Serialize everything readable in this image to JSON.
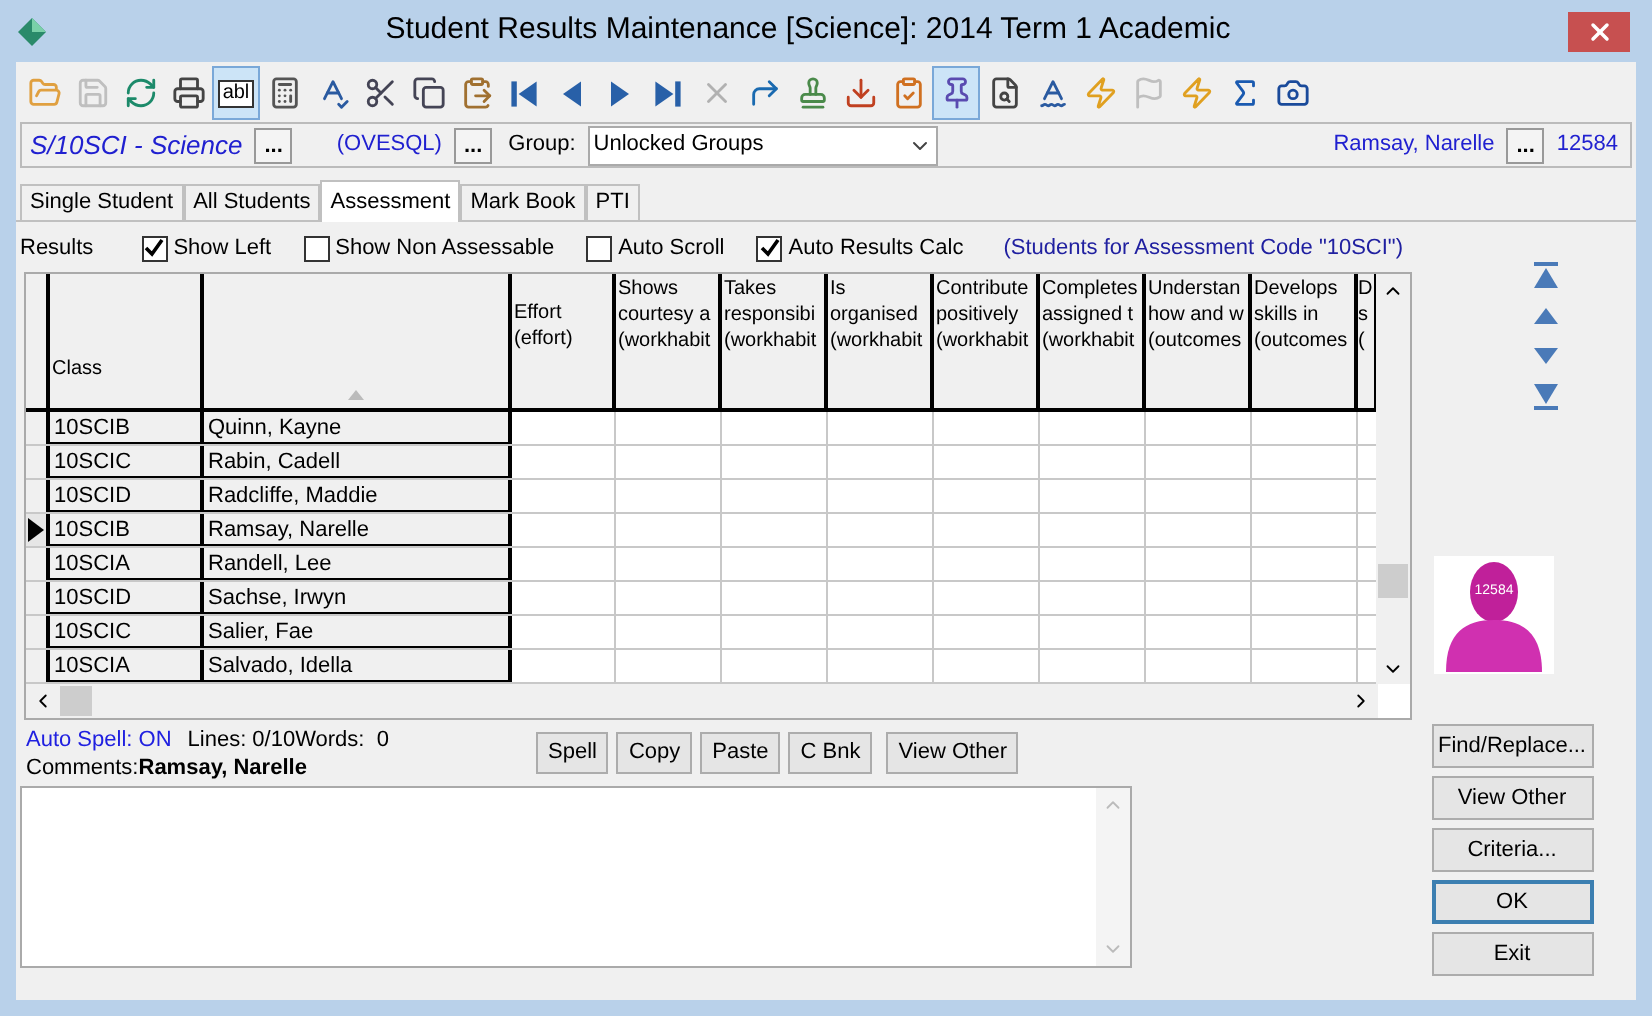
{
  "window": {
    "title": "Student Results Maintenance  [Science]:  2014 Term 1 Academic"
  },
  "toolbar": [
    {
      "kind": "open",
      "selected": false,
      "disabled": false
    },
    {
      "kind": "save",
      "selected": false,
      "disabled": true
    },
    {
      "kind": "refresh",
      "selected": false,
      "disabled": false
    },
    {
      "kind": "print",
      "selected": false,
      "disabled": false
    },
    {
      "kind": "field",
      "label": "abl",
      "selected": true,
      "disabled": false
    },
    {
      "kind": "calculator",
      "selected": false,
      "disabled": false
    },
    {
      "kind": "spell",
      "selected": false,
      "disabled": false
    },
    {
      "kind": "cut",
      "selected": false,
      "disabled": false
    },
    {
      "kind": "copy",
      "selected": false,
      "disabled": false
    },
    {
      "kind": "paste",
      "selected": false,
      "disabled": false
    },
    {
      "kind": "first",
      "selected": false,
      "disabled": false
    },
    {
      "kind": "prev",
      "selected": false,
      "disabled": false
    },
    {
      "kind": "next",
      "selected": false,
      "disabled": false
    },
    {
      "kind": "last",
      "selected": false,
      "disabled": false
    },
    {
      "kind": "delete",
      "selected": false,
      "disabled": true
    },
    {
      "kind": "jump",
      "selected": false,
      "disabled": false
    },
    {
      "kind": "approve",
      "selected": false,
      "disabled": false
    },
    {
      "kind": "import",
      "selected": false,
      "disabled": false
    },
    {
      "kind": "checklist",
      "selected": false,
      "disabled": false
    },
    {
      "kind": "pin",
      "selected": true,
      "disabled": false
    },
    {
      "kind": "preview",
      "selected": false,
      "disabled": false
    },
    {
      "kind": "spelladd",
      "selected": false,
      "disabled": false
    },
    {
      "kind": "font",
      "selected": false,
      "disabled": false
    },
    {
      "kind": "flag",
      "selected": false,
      "disabled": true
    },
    {
      "kind": "function",
      "selected": false,
      "disabled": false
    },
    {
      "kind": "sum",
      "selected": false,
      "disabled": false
    },
    {
      "kind": "camera",
      "selected": false,
      "disabled": false
    }
  ],
  "selector_bar": {
    "course": "S/10SCI - Science",
    "course_button": "...",
    "source": "(OVESQL)",
    "source_button": "...",
    "group_label": "Group:",
    "group_value": "Unlocked Groups",
    "student": "Ramsay, Narelle",
    "student_button": "...",
    "student_id": "12584"
  },
  "tabs": [
    {
      "label": "Single Student",
      "selected": false
    },
    {
      "label": "All Students",
      "selected": false
    },
    {
      "label": "Assessment",
      "selected": true
    },
    {
      "label": "Mark Book",
      "selected": false
    },
    {
      "label": "PTI",
      "selected": false
    }
  ],
  "options": {
    "label": "Results",
    "checkboxes": [
      {
        "label": "Show Left",
        "checked": true
      },
      {
        "label": "Show Non Assessable",
        "checked": false
      },
      {
        "label": "Auto Scroll",
        "checked": false
      },
      {
        "label": "Auto Results Calc",
        "checked": true
      }
    ],
    "note": "(Students for Assessment Code \"10SCI\")"
  },
  "table": {
    "columns": [
      {
        "lines": [
          "Class"
        ]
      },
      {
        "sorted": true
      },
      {
        "lines": [
          "Effort",
          "(effort)"
        ]
      },
      {
        "lines": [
          "Shows",
          "courtesy a",
          "(workhabit"
        ]
      },
      {
        "lines": [
          "Takes",
          "responsibi",
          "(workhabit"
        ]
      },
      {
        "lines": [
          "Is",
          "organised",
          "(workhabit"
        ]
      },
      {
        "lines": [
          "Contribute",
          "positively",
          "(workhabit"
        ]
      },
      {
        "lines": [
          "Completes",
          "assigned t",
          "(workhabit"
        ]
      },
      {
        "lines": [
          "Understan",
          "how and w",
          "(outcomes"
        ]
      },
      {
        "lines": [
          "Develops",
          "skills in",
          "(outcomes"
        ]
      },
      {
        "lines": [
          "D",
          "s",
          "("
        ]
      }
    ],
    "rows": [
      {
        "class": "10SCIB",
        "name": "Quinn, Kayne",
        "selected": false
      },
      {
        "class": "10SCIC",
        "name": "Rabin, Cadell",
        "selected": false
      },
      {
        "class": "10SCID",
        "name": "Radcliffe, Maddie",
        "selected": false
      },
      {
        "class": "10SCIB",
        "name": "Ramsay, Narelle",
        "selected": true
      },
      {
        "class": "10SCIA",
        "name": "Randell, Lee",
        "selected": false
      },
      {
        "class": "10SCID",
        "name": "Sachse, Irwyn",
        "selected": false
      },
      {
        "class": "10SCIC",
        "name": "Salier, Fae",
        "selected": false
      },
      {
        "class": "10SCIA",
        "name": "Salvado, Idella",
        "selected": false
      }
    ]
  },
  "avatar": {
    "label": "12584"
  },
  "status": {
    "auto_spell": "Auto Spell: ON",
    "lines": "Lines: 0/10",
    "words": "Words:  0"
  },
  "comments": {
    "label": "Comments:",
    "student": "Ramsay, Narelle"
  },
  "comment_buttons": [
    "Spell",
    "Copy",
    "Paste",
    "C Bnk",
    "View Other"
  ],
  "side_buttons": [
    {
      "label": "Find/Replace...",
      "default": false
    },
    {
      "label": "View Other",
      "default": false
    },
    {
      "label": "Criteria...",
      "default": false
    },
    {
      "label": "OK",
      "default": true
    },
    {
      "label": "Exit",
      "default": false
    }
  ]
}
